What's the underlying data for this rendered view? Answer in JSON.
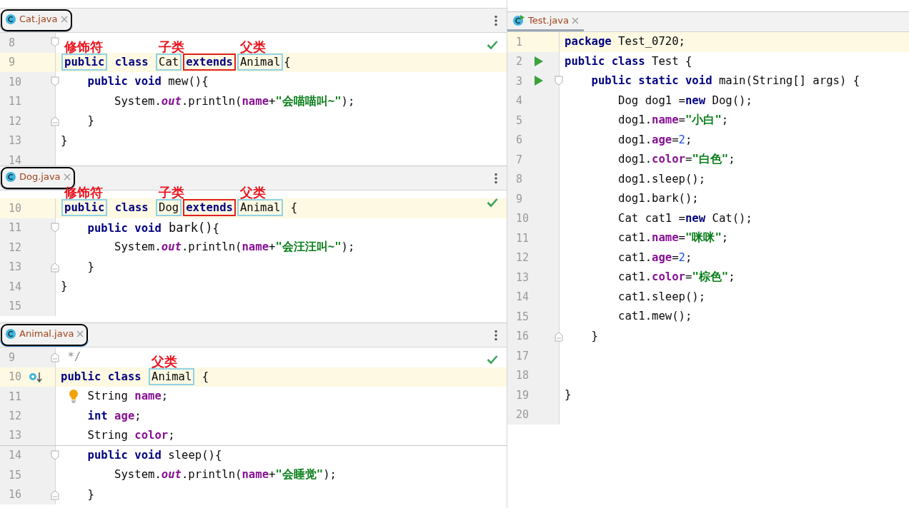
{
  "left_panes": [
    {
      "tab": {
        "filename": "Cat.java",
        "circled": true,
        "focused": false
      },
      "inspection_ok": true,
      "lines": [
        {
          "number": "8",
          "markers": [
            {
              "kind": "fold_start"
            }
          ]
        },
        {
          "number": "9",
          "current": true,
          "tokens": [
            {
              "text": "public",
              "kind": "keyword",
              "color": "#8fd3e6",
              "note": "修饰符"
            },
            {
              "text": " class ",
              "kind": "keyword"
            },
            {
              "text": "Cat",
              "color": "#8fd3e6",
              "note": "子类"
            },
            {
              "text": "extends",
              "kind": "keyword",
              "color": "#e02020"
            },
            {
              "text": "Animal",
              "color": "#8fd3e6",
              "note": "父类"
            },
            {
              "text": "{"
            }
          ]
        },
        {
          "number": "10",
          "markers": [
            {
              "kind": "fold_start"
            }
          ],
          "tokens": [
            {
              "text": "    public void",
              "kind": "keyword"
            },
            {
              "text": " mew(){"
            }
          ]
        },
        {
          "number": "11",
          "tokens": [
            {
              "text": "        System."
            },
            {
              "text": "out",
              "kind": "static"
            },
            {
              "text": ".println("
            },
            {
              "text": "name",
              "kind": "field"
            },
            {
              "text": "+"
            },
            {
              "text": "\"会喵喵叫~\"",
              "kind": "string"
            },
            {
              "text": ");"
            }
          ]
        },
        {
          "number": "12",
          "markers": [
            {
              "kind": "fold_end"
            }
          ],
          "tokens": [
            {
              "text": "    }"
            }
          ]
        },
        {
          "number": "13",
          "tokens": [
            {
              "text": "}"
            }
          ]
        },
        {
          "number": "14"
        }
      ]
    },
    {
      "tab": {
        "filename": "Dog.java",
        "circled": true,
        "focused": false
      },
      "inspection_ok": true,
      "lines": [
        {
          "number": "10",
          "current": true,
          "tokens": [
            {
              "text": "public",
              "kind": "keyword",
              "color": "#8fd3e6",
              "note": "修饰符"
            },
            {
              "text": " class ",
              "kind": "keyword"
            },
            {
              "text": "Dog",
              "color": "#8fd3e6",
              "note": "子类"
            },
            {
              "text": "extends",
              "kind": "keyword",
              "color": "#e02020"
            },
            {
              "text": "Animal",
              "color": "#8fd3e6",
              "note": "父类"
            },
            {
              "text": " {"
            }
          ]
        },
        {
          "number": "11",
          "markers": [
            {
              "kind": "fold_start"
            }
          ],
          "tokens": [
            {
              "text": "    public void",
              "kind": "keyword"
            },
            {
              "text": " bark()",
              "kind": "pasted"
            },
            {
              "text": "{"
            }
          ]
        },
        {
          "number": "12",
          "tokens": [
            {
              "text": "        System."
            },
            {
              "text": "out",
              "kind": "static"
            },
            {
              "text": ".println("
            },
            {
              "text": "name",
              "kind": "field"
            },
            {
              "text": "+"
            },
            {
              "text": "\"会汪汪叫~\"",
              "kind": "string"
            },
            {
              "text": ");"
            }
          ]
        },
        {
          "number": "13",
          "markers": [
            {
              "kind": "fold_end"
            }
          ],
          "tokens": [
            {
              "text": "    }"
            }
          ]
        },
        {
          "number": "14",
          "tokens": [
            {
              "text": "}"
            }
          ]
        },
        {
          "number": "15"
        }
      ]
    },
    {
      "tab": {
        "filename": "Animal.java",
        "circled": true,
        "focused": true
      },
      "inspection_ok": true,
      "lines": [
        {
          "number": "9",
          "markers": [
            {
              "kind": "fold_end"
            }
          ],
          "tokens": [
            {
              "text": " */",
              "kind": "comment"
            }
          ]
        },
        {
          "number": "10",
          "current": true,
          "markers": [
            {
              "kind": "implemented"
            }
          ],
          "tokens": [
            {
              "text": "public class ",
              "kind": "keyword"
            },
            {
              "text": "Animal",
              "color": "#8fd3e6",
              "note": "父类"
            },
            {
              "text": " {"
            }
          ]
        },
        {
          "number": "11",
          "markers": [
            {
              "kind": "bulb"
            }
          ],
          "tokens": [
            {
              "text": "    String "
            },
            {
              "text": "name",
              "kind": "field"
            },
            {
              "text": ";"
            }
          ]
        },
        {
          "number": "12",
          "tokens": [
            {
              "text": "    int",
              "kind": "keyword"
            },
            {
              "text": " age",
              "kind": "field"
            },
            {
              "text": ";"
            }
          ]
        },
        {
          "number": "13",
          "separator": true,
          "tokens": [
            {
              "text": "    String "
            },
            {
              "text": "color",
              "kind": "field"
            },
            {
              "text": ";"
            }
          ]
        },
        {
          "number": "14",
          "markers": [
            {
              "kind": "fold_start"
            }
          ],
          "tokens": [
            {
              "text": "    public void",
              "kind": "keyword"
            },
            {
              "text": " sleep(){"
            }
          ]
        },
        {
          "number": "15",
          "tokens": [
            {
              "text": "        System."
            },
            {
              "text": "out",
              "kind": "static"
            },
            {
              "text": ".println("
            },
            {
              "text": "name",
              "kind": "field"
            },
            {
              "text": "+"
            },
            {
              "text": "\"会睡觉\"",
              "kind": "string"
            },
            {
              "text": ");"
            }
          ]
        },
        {
          "number": "16",
          "markers": [
            {
              "kind": "fold_end"
            }
          ],
          "tokens": [
            {
              "text": "    }"
            }
          ]
        }
      ]
    }
  ],
  "right_pane": {
    "tab": {
      "filename": "Test.java",
      "runnable": true,
      "circled": false,
      "focused": false
    },
    "lines": [
      {
        "number": "1",
        "current": true,
        "tokens": [
          {
            "text": "package",
            "kind": "keyword"
          },
          {
            "text": " Test_0720;"
          }
        ]
      },
      {
        "number": "2",
        "markers": [
          {
            "kind": "run"
          }
        ],
        "tokens": [
          {
            "text": "public class",
            "kind": "keyword"
          },
          {
            "text": " Test {"
          }
        ]
      },
      {
        "number": "3",
        "markers": [
          {
            "kind": "run"
          },
          {
            "kind": "fold_start"
          }
        ],
        "tokens": [
          {
            "text": "    public static void",
            "kind": "keyword"
          },
          {
            "text": " main(String[] args) {"
          }
        ]
      },
      {
        "number": "4",
        "tokens": [
          {
            "text": "        Dog dog1 ="
          },
          {
            "text": "new",
            "kind": "keyword"
          },
          {
            "text": " Dog();"
          }
        ]
      },
      {
        "number": "5",
        "tokens": [
          {
            "text": "        dog1."
          },
          {
            "text": "name",
            "kind": "field"
          },
          {
            "text": "="
          },
          {
            "text": "\"小白\"",
            "kind": "string"
          },
          {
            "text": ";"
          }
        ]
      },
      {
        "number": "6",
        "tokens": [
          {
            "text": "        dog1."
          },
          {
            "text": "age",
            "kind": "field"
          },
          {
            "text": "="
          },
          {
            "text": "2",
            "kind": "number"
          },
          {
            "text": ";"
          }
        ]
      },
      {
        "number": "7",
        "tokens": [
          {
            "text": "        dog1."
          },
          {
            "text": "color",
            "kind": "field"
          },
          {
            "text": "="
          },
          {
            "text": "\"白色\"",
            "kind": "string"
          },
          {
            "text": ";"
          }
        ]
      },
      {
        "number": "8",
        "tokens": [
          {
            "text": "        dog1.sleep();"
          }
        ]
      },
      {
        "number": "9",
        "tokens": [
          {
            "text": "        dog1.bark();"
          }
        ]
      },
      {
        "number": "10",
        "tokens": [
          {
            "text": "        Cat cat1 ="
          },
          {
            "text": "new",
            "kind": "keyword"
          },
          {
            "text": " Cat();"
          }
        ]
      },
      {
        "number": "11",
        "tokens": [
          {
            "text": "        cat1."
          },
          {
            "text": "name",
            "kind": "field"
          },
          {
            "text": "="
          },
          {
            "text": "\"咪咪\"",
            "kind": "string"
          },
          {
            "text": ";"
          }
        ]
      },
      {
        "number": "12",
        "tokens": [
          {
            "text": "        cat1."
          },
          {
            "text": "age",
            "kind": "field"
          },
          {
            "text": "="
          },
          {
            "text": "2",
            "kind": "number"
          },
          {
            "text": ";"
          }
        ]
      },
      {
        "number": "13",
        "tokens": [
          {
            "text": "        cat1."
          },
          {
            "text": "color",
            "kind": "field"
          },
          {
            "text": "="
          },
          {
            "text": "\"棕色\"",
            "kind": "string"
          },
          {
            "text": ";"
          }
        ]
      },
      {
        "number": "14",
        "tokens": [
          {
            "text": "        cat1.sleep();"
          }
        ]
      },
      {
        "number": "15",
        "tokens": [
          {
            "text": "        cat1.mew();"
          }
        ]
      },
      {
        "number": "16",
        "markers": [
          {
            "kind": "fold_end"
          }
        ],
        "tokens": [
          {
            "text": "    }"
          }
        ]
      },
      {
        "number": "17"
      },
      {
        "number": "18"
      },
      {
        "number": "19",
        "tokens": [
          {
            "text": "}"
          }
        ]
      },
      {
        "number": "20"
      }
    ]
  }
}
